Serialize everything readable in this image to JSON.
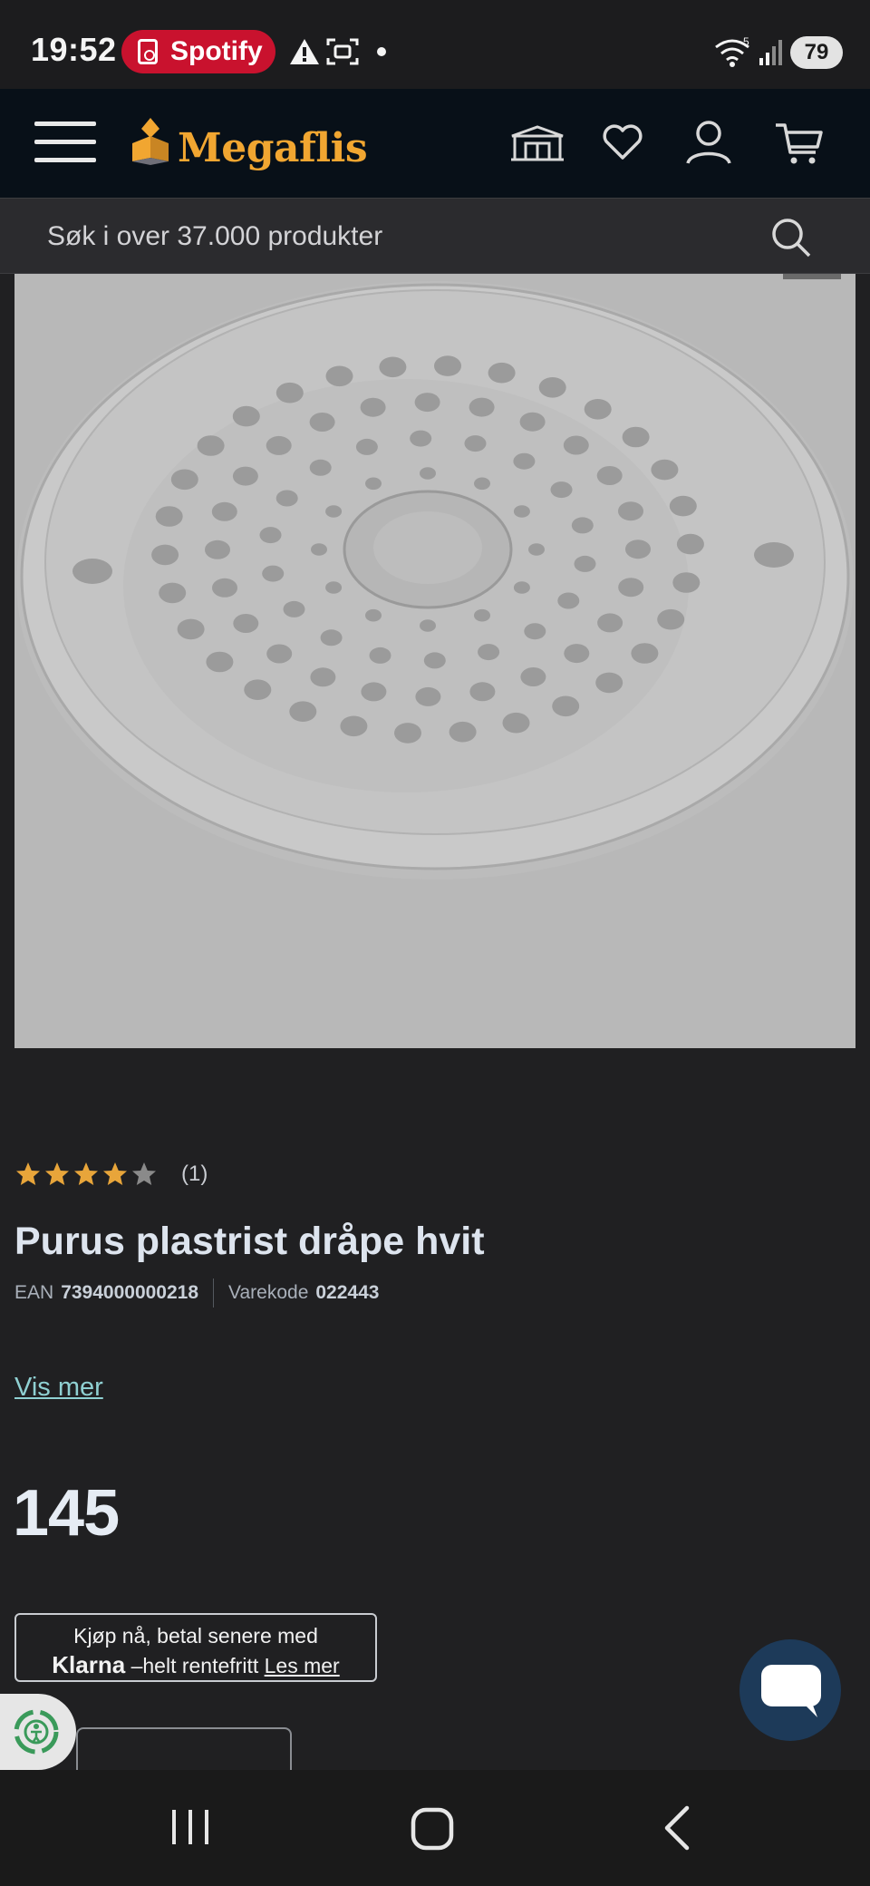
{
  "status_bar": {
    "time": "19:52",
    "notification_app": "Spotify",
    "battery": "79",
    "icons": [
      "spotify-icon",
      "warning-icon",
      "screenshot-icon",
      "dot-icon",
      "wifi-icon",
      "signal-icon",
      "battery-icon"
    ]
  },
  "header": {
    "logo": "Megaflis",
    "icons": [
      "menu-icon",
      "store-icon",
      "heart-icon",
      "user-icon",
      "cart-icon"
    ]
  },
  "search": {
    "placeholder": "Søk i over 37.000 produkter",
    "icon": "search-icon"
  },
  "product": {
    "rating_stars": 4,
    "rating_max": 5,
    "rating_count": "(1)",
    "title": "Purus plastrist dråpe hvit",
    "ean_label": "EAN",
    "ean": "7394000000218",
    "code_label": "Varekode",
    "code": "022443",
    "show_more": "Vis mer",
    "price": "145",
    "image_icon": "drain-grate-image"
  },
  "klarna": {
    "line1": "Kjøp nå, betal senere med",
    "brand": "Klarna",
    "tagline": " –helt rentefritt ",
    "link": "Les mer"
  },
  "colors": {
    "background": "#202022",
    "header": "#081018",
    "logo": "#f1a631",
    "star": "#e8a53a",
    "link": "#8fd0d2",
    "spotify": "#c9122e",
    "chat": "#1d3a59"
  }
}
